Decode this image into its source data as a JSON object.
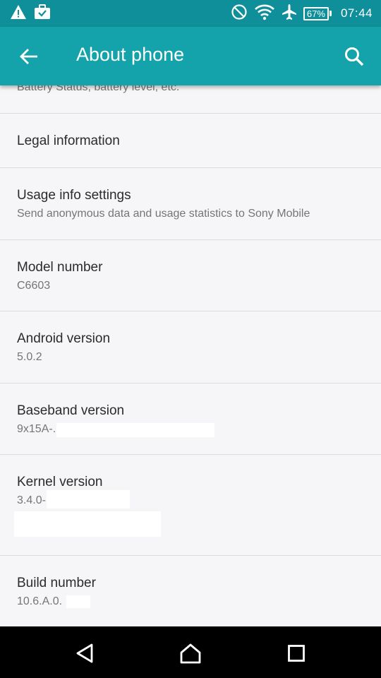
{
  "status_bar": {
    "time": "07:44",
    "battery_percent": "67%",
    "icons": [
      "warning-icon",
      "work-profile-icon",
      "do-not-disturb-icon",
      "wifi-icon",
      "airplane-icon",
      "battery-icon"
    ]
  },
  "app_bar": {
    "title": "About phone",
    "back_icon": "arrow-back-icon",
    "search_icon": "search-icon",
    "color": "#15a3ab",
    "status_color": "#0f8f99"
  },
  "items": {
    "battery": {
      "subtitle": "Battery Status, battery level, etc."
    },
    "legal": {
      "title": "Legal information"
    },
    "usage": {
      "title": "Usage info settings",
      "subtitle": "Send anonymous data and usage statistics to Sony Mobile"
    },
    "model": {
      "title": "Model number",
      "subtitle": "C6603"
    },
    "android": {
      "title": "Android version",
      "subtitle": "5.0.2"
    },
    "baseband": {
      "title": "Baseband version",
      "subtitle": "9x15A-."
    },
    "kernel": {
      "title": "Kernel version",
      "subtitle": "3.4.0-"
    },
    "build": {
      "title": "Build number",
      "subtitle": "10.6.A.0."
    }
  },
  "nav_bar": {
    "icons": [
      "back-triangle-icon",
      "home-icon",
      "recents-icon"
    ]
  }
}
